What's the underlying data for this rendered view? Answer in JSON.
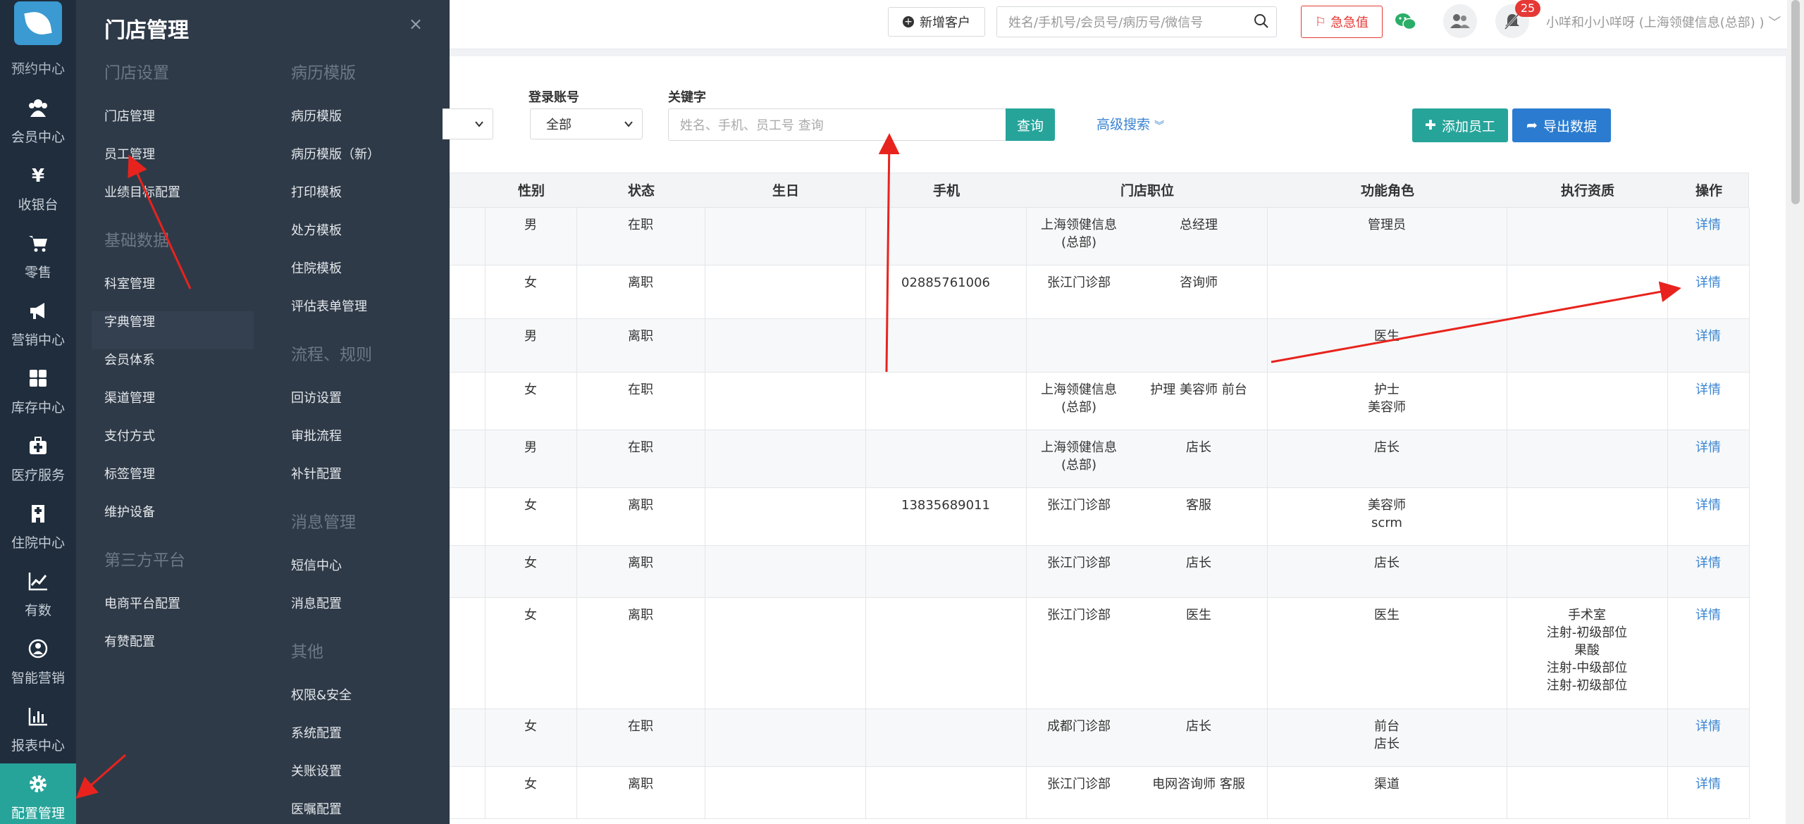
{
  "sidebar": {
    "partial_label": "预约中心",
    "items": [
      {
        "label": "会员中心",
        "icon": "members-icon"
      },
      {
        "label": "收银台",
        "icon": "yen-icon"
      },
      {
        "label": "零售",
        "icon": "cart-icon"
      },
      {
        "label": "营销中心",
        "icon": "megaphone-icon"
      },
      {
        "label": "库存中心",
        "icon": "grid-icon"
      },
      {
        "label": "医疗服务",
        "icon": "medkit-icon"
      },
      {
        "label": "住院中心",
        "icon": "hospital-icon"
      },
      {
        "label": "有数",
        "icon": "line-chart-icon"
      },
      {
        "label": "智能营销",
        "icon": "smart-icon"
      },
      {
        "label": "报表中心",
        "icon": "bar-chart-icon"
      },
      {
        "label": "配置管理",
        "icon": "gear-icon",
        "active": true
      }
    ]
  },
  "panel": {
    "title": "门店管理",
    "close": "×",
    "col1": [
      {
        "type": "section",
        "label": "门店设置"
      },
      {
        "type": "item",
        "label": "门店管理"
      },
      {
        "type": "item",
        "label": "员工管理"
      },
      {
        "type": "item",
        "label": "业绩目标配置"
      },
      {
        "type": "section",
        "label": "基础数据"
      },
      {
        "type": "item",
        "label": "科室管理"
      },
      {
        "type": "item",
        "label": "字典管理",
        "highlight": true
      },
      {
        "type": "item",
        "label": "会员体系"
      },
      {
        "type": "item",
        "label": "渠道管理"
      },
      {
        "type": "item",
        "label": "支付方式"
      },
      {
        "type": "item",
        "label": "标签管理"
      },
      {
        "type": "item",
        "label": "维护设备"
      },
      {
        "type": "section",
        "label": "第三方平台"
      },
      {
        "type": "item",
        "label": "电商平台配置"
      },
      {
        "type": "item",
        "label": "有赞配置"
      }
    ],
    "col2": [
      {
        "type": "section",
        "label": "病历模版"
      },
      {
        "type": "item",
        "label": "病历模版"
      },
      {
        "type": "item",
        "label": "病历模版（新）"
      },
      {
        "type": "item",
        "label": "打印模板"
      },
      {
        "type": "item",
        "label": "处方模板"
      },
      {
        "type": "item",
        "label": "住院模板"
      },
      {
        "type": "item",
        "label": "评估表单管理"
      },
      {
        "type": "section",
        "label": "流程、规则"
      },
      {
        "type": "item",
        "label": "回访设置"
      },
      {
        "type": "item",
        "label": "审批流程"
      },
      {
        "type": "item",
        "label": "补针配置"
      },
      {
        "type": "section",
        "label": "消息管理"
      },
      {
        "type": "item",
        "label": "短信中心"
      },
      {
        "type": "item",
        "label": "消息配置"
      },
      {
        "type": "section",
        "label": "其他"
      },
      {
        "type": "item",
        "label": "权限&安全"
      },
      {
        "type": "item",
        "label": "系统配置"
      },
      {
        "type": "item",
        "label": "关账设置"
      },
      {
        "type": "item",
        "label": "医嘱配置"
      }
    ]
  },
  "topbar": {
    "new_customer": "新增客户",
    "search_placeholder": "姓名/手机号/会员号/病历号/微信号",
    "alert_label": "急急值",
    "badge_count": "25",
    "user": "小咩和小小咩呀 (上海领健信息(总部) )"
  },
  "filters": {
    "login_label": "登录账号",
    "login_value": "全部",
    "keyword_label": "关键字",
    "keyword_placeholder": "姓名、手机、员工号 查询",
    "query_button": "查询",
    "advanced": "高级搜索",
    "add_staff": "添加员工",
    "export": "导出数据"
  },
  "table": {
    "headers": [
      "性别",
      "状态",
      "生日",
      "手机",
      "门店职位",
      "功能角色",
      "执行资质",
      "操作"
    ],
    "rows": [
      {
        "gender": "男",
        "status": "在职",
        "birthday": "",
        "phone": "",
        "store": "上海领健信息\n(总部)",
        "position": "总经理",
        "role": "管理员",
        "qual": "",
        "op": "详情"
      },
      {
        "gender": "女",
        "status": "离职",
        "birthday": "",
        "phone": "02885761006",
        "store": "张江门诊部",
        "position": "咨询师",
        "role": "",
        "qual": "",
        "op": "详情"
      },
      {
        "gender": "男",
        "status": "离职",
        "birthday": "",
        "phone": "",
        "store": "",
        "position": "",
        "role": "医生",
        "qual": "",
        "op": "详情"
      },
      {
        "gender": "女",
        "status": "在职",
        "birthday": "",
        "phone": "",
        "store": "上海领健信息\n(总部)",
        "position": "护理  美容师  前台",
        "role": "护士\n美容师",
        "qual": "",
        "op": "详情"
      },
      {
        "gender": "男",
        "status": "在职",
        "birthday": "",
        "phone": "",
        "store": "上海领健信息\n(总部)",
        "position": "店长",
        "role": "店长",
        "qual": "",
        "op": "详情"
      },
      {
        "gender": "女",
        "status": "离职",
        "birthday": "",
        "phone": "13835689011",
        "store": "张江门诊部",
        "position": "客服",
        "role": "美容师\nscrm",
        "qual": "",
        "op": "详情"
      },
      {
        "gender": "女",
        "status": "离职",
        "birthday": "",
        "phone": "",
        "store": "张江门诊部",
        "position": "店长",
        "role": "店长",
        "qual": "",
        "op": "详情"
      },
      {
        "gender": "女",
        "status": "离职",
        "birthday": "",
        "phone": "",
        "store": "张江门诊部",
        "position": "医生",
        "role": "医生",
        "qual": "手术室\n注射-初级部位\n果酸\n注射-中级部位\n注射-初级部位",
        "op": "详情"
      },
      {
        "gender": "女",
        "status": "在职",
        "birthday": "",
        "phone": "",
        "store": "成都门诊部",
        "position": "店长",
        "role": "前台\n店长",
        "qual": "",
        "op": "详情"
      },
      {
        "gender": "女",
        "status": "离职",
        "birthday": "",
        "phone": "",
        "store": "张江门诊部",
        "position": "电网咨询师  客服",
        "role": "渠道",
        "qual": "",
        "op": "详情"
      }
    ]
  },
  "colors": {
    "rail": "#1f2d3d",
    "panel": "#2f3a48",
    "accent": "#27a49a",
    "blue": "#2b7cd0",
    "link": "#3a84d1",
    "alert": "#e53935"
  }
}
